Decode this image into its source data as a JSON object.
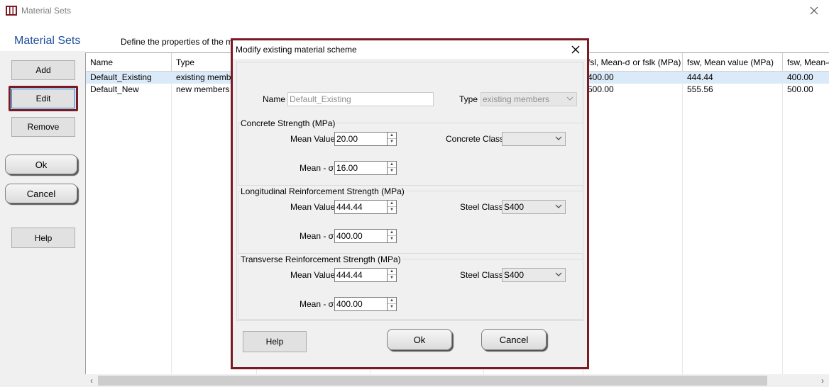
{
  "window": {
    "title": "Material Sets"
  },
  "header": {
    "section_title": "Material Sets",
    "description": "Define the properties of the m"
  },
  "left_panel": {
    "add_label": "Add",
    "edit_label": "Edit",
    "remove_label": "Remove",
    "ok_label": "Ok",
    "cancel_label": "Cancel",
    "help_label": "Help"
  },
  "table": {
    "columns": [
      "Name",
      "Type",
      "",
      "",
      "",
      "",
      "fsl, Mean-σ or fslk (MPa)",
      "fsw, Mean value (MPa)",
      "fsw, Mean-σ"
    ],
    "rows": [
      {
        "name": "Default_Existing",
        "type": "existing member",
        "fsl_mean_sigma": "400.00",
        "fsw_mean": "444.44",
        "fsw_mean_sigma": "400.00"
      },
      {
        "name": "Default_New",
        "type": "new members",
        "fsl_mean_sigma": "500.00",
        "fsw_mean": "555.56",
        "fsw_mean_sigma": "500.00"
      }
    ]
  },
  "dialog": {
    "title": "Modify existing material scheme",
    "name_label": "Name",
    "name_value": "Default_Existing",
    "type_label": "Type",
    "type_value": "existing members",
    "concrete": {
      "group_label": "Concrete Strength (MPa)",
      "mean_label": "Mean Value",
      "mean_value": "20.00",
      "sigma_label": "Mean - σ",
      "sigma_value": "16.00",
      "class_label": "Concrete Class",
      "class_value": ""
    },
    "longitudinal": {
      "group_label": "Longitudinal Reinforcement Strength (MPa)",
      "mean_label": "Mean Value",
      "mean_value": "444.44",
      "sigma_label": "Mean - σ",
      "sigma_value": "400.00",
      "class_label": "Steel Class",
      "class_value": "S400"
    },
    "transverse": {
      "group_label": "Transverse Reinforcement Strength (MPa)",
      "mean_label": "Mean Value",
      "mean_value": "444.44",
      "sigma_label": "Mean - σ",
      "sigma_value": "400.00",
      "class_label": "Steel Class",
      "class_value": "S400"
    },
    "help_label": "Help",
    "ok_label": "Ok",
    "cancel_label": "Cancel"
  },
  "colors": {
    "accent_border": "#7a1a22",
    "section_title": "#1e4f9b",
    "selection": "#dbeaf8"
  },
  "icons": {
    "app": "material-sets-app-icon",
    "close": "close-icon",
    "chevron": "chevron-down-icon",
    "spin": "spin-arrows-icon"
  }
}
